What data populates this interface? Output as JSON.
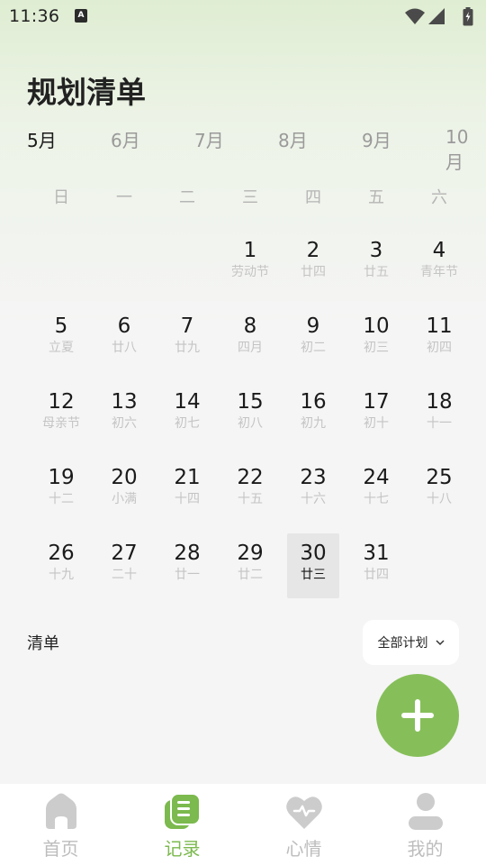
{
  "status_bar": {
    "time": "11:36",
    "notification_icon": "a-icon",
    "icons": [
      "wifi-icon",
      "signal-icon",
      "battery-icon"
    ]
  },
  "header": {
    "title": "规划清单"
  },
  "month_tabs": [
    {
      "label": "5月",
      "active": true
    },
    {
      "label": "6月",
      "active": false
    },
    {
      "label": "7月",
      "active": false
    },
    {
      "label": "8月",
      "active": false
    },
    {
      "label": "9月",
      "active": false
    },
    {
      "label": "10月",
      "active": false
    }
  ],
  "weekdays": [
    "日",
    "一",
    "二",
    "三",
    "四",
    "五",
    "六"
  ],
  "calendar": {
    "days": [
      {
        "day": "1",
        "lunar": "劳动节"
      },
      {
        "day": "2",
        "lunar": "廿四"
      },
      {
        "day": "3",
        "lunar": "廿五"
      },
      {
        "day": "4",
        "lunar": "青年节"
      },
      {
        "day": "5",
        "lunar": "立夏"
      },
      {
        "day": "6",
        "lunar": "廿八"
      },
      {
        "day": "7",
        "lunar": "廿九"
      },
      {
        "day": "8",
        "lunar": "四月"
      },
      {
        "day": "9",
        "lunar": "初二"
      },
      {
        "day": "10",
        "lunar": "初三"
      },
      {
        "day": "11",
        "lunar": "初四"
      },
      {
        "day": "12",
        "lunar": "母亲节"
      },
      {
        "day": "13",
        "lunar": "初六"
      },
      {
        "day": "14",
        "lunar": "初七"
      },
      {
        "day": "15",
        "lunar": "初八"
      },
      {
        "day": "16",
        "lunar": "初九"
      },
      {
        "day": "17",
        "lunar": "初十"
      },
      {
        "day": "18",
        "lunar": "十一"
      },
      {
        "day": "19",
        "lunar": "十二"
      },
      {
        "day": "20",
        "lunar": "小满"
      },
      {
        "day": "21",
        "lunar": "十四"
      },
      {
        "day": "22",
        "lunar": "十五"
      },
      {
        "day": "23",
        "lunar": "十六"
      },
      {
        "day": "24",
        "lunar": "十七"
      },
      {
        "day": "25",
        "lunar": "十八"
      },
      {
        "day": "26",
        "lunar": "十九"
      },
      {
        "day": "27",
        "lunar": "二十"
      },
      {
        "day": "28",
        "lunar": "廿一"
      },
      {
        "day": "29",
        "lunar": "廿二"
      },
      {
        "day": "30",
        "lunar": "廿三",
        "selected": true
      },
      {
        "day": "31",
        "lunar": "廿四"
      }
    ]
  },
  "list_section": {
    "label": "清单",
    "filter_label": "全部计划",
    "filter_icon": "chevron-down-icon",
    "add_icon": "plus-icon"
  },
  "colors": {
    "accent": "#86bf5a",
    "nav_active": "#7cb94e",
    "nav_inactive": "#bdbdbd",
    "selected_day_bg": "#e6e6e6"
  },
  "bottom_nav": [
    {
      "label": "首页",
      "icon": "home-icon",
      "active": false
    },
    {
      "label": "记录",
      "icon": "notes-icon",
      "active": true
    },
    {
      "label": "心情",
      "icon": "heart-icon",
      "active": false
    },
    {
      "label": "我的",
      "icon": "user-icon",
      "active": false
    }
  ]
}
